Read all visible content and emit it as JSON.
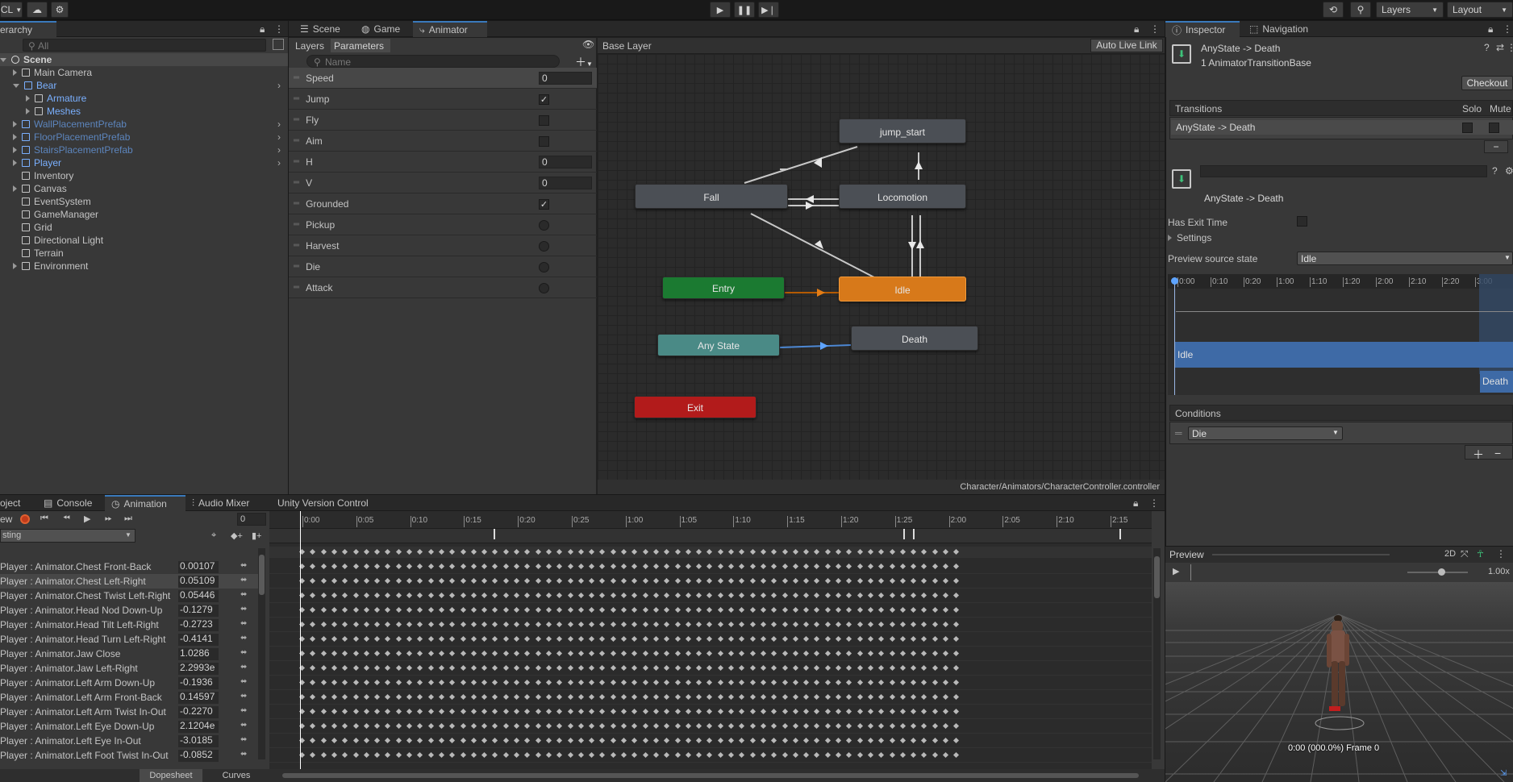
{
  "toolbar": {
    "account": "CL",
    "layers": "Layers",
    "layout": "Layout"
  },
  "hierarchy": {
    "tab": "erarchy",
    "search_placeholder": "All",
    "items": [
      {
        "label": "Scene",
        "depth": 0,
        "icon": "scene",
        "color": "#d2d2d2",
        "arrow": "down"
      },
      {
        "label": "Main Camera",
        "depth": 1,
        "icon": "cube",
        "color": "#c4c4c4",
        "arrow": "right"
      },
      {
        "label": "Bear",
        "depth": 1,
        "icon": "cube-blue",
        "color": "#7ab0ff",
        "arrow": "down"
      },
      {
        "label": "Armature",
        "depth": 2,
        "icon": "cube",
        "color": "#7ab0ff",
        "arrow": "right"
      },
      {
        "label": "Meshes",
        "depth": 2,
        "icon": "cube",
        "color": "#7ab0ff",
        "arrow": "right"
      },
      {
        "label": "WallPlacementPrefab",
        "depth": 1,
        "icon": "cube-blue",
        "color": "#5c85bd",
        "arrow": "right"
      },
      {
        "label": "FloorPlacementPrefab",
        "depth": 1,
        "icon": "cube-blue",
        "color": "#5c85bd",
        "arrow": "right"
      },
      {
        "label": "StairsPlacementPrefab",
        "depth": 1,
        "icon": "cube-blue",
        "color": "#5c85bd",
        "arrow": "right"
      },
      {
        "label": "Player",
        "depth": 1,
        "icon": "cube-blue",
        "color": "#7ab0ff",
        "arrow": "right"
      },
      {
        "label": "Inventory",
        "depth": 1,
        "icon": "cube",
        "color": "#c4c4c4",
        "arrow": ""
      },
      {
        "label": "Canvas",
        "depth": 1,
        "icon": "cube",
        "color": "#c4c4c4",
        "arrow": "right"
      },
      {
        "label": "EventSystem",
        "depth": 1,
        "icon": "cube",
        "color": "#c4c4c4",
        "arrow": ""
      },
      {
        "label": "GameManager",
        "depth": 1,
        "icon": "cube",
        "color": "#c4c4c4",
        "arrow": ""
      },
      {
        "label": "Grid",
        "depth": 1,
        "icon": "cube",
        "color": "#c4c4c4",
        "arrow": ""
      },
      {
        "label": "Directional Light",
        "depth": 1,
        "icon": "cube",
        "color": "#c4c4c4",
        "arrow": ""
      },
      {
        "label": "Terrain",
        "depth": 1,
        "icon": "cube",
        "color": "#c4c4c4",
        "arrow": ""
      },
      {
        "label": "Environment",
        "depth": 1,
        "icon": "cube",
        "color": "#c4c4c4",
        "arrow": "right"
      }
    ]
  },
  "center_tabs": {
    "scene": "Scene",
    "game": "Game",
    "animator": "Animator"
  },
  "animator": {
    "layers_tab": "Layers",
    "parameters_tab": "Parameters",
    "search_placeholder": "Name",
    "breadcrumb": "Base Layer",
    "auto_live_link": "Auto Live Link",
    "footer_path": "Character/Animators/CharacterController.controller",
    "parameters": [
      {
        "name": "Speed",
        "type": "float",
        "value": "0"
      },
      {
        "name": "Jump",
        "type": "bool",
        "value": true
      },
      {
        "name": "Fly",
        "type": "bool",
        "value": false
      },
      {
        "name": "Aim",
        "type": "bool",
        "value": false
      },
      {
        "name": "H",
        "type": "float",
        "value": "0"
      },
      {
        "name": "V",
        "type": "float",
        "value": "0"
      },
      {
        "name": "Grounded",
        "type": "bool",
        "value": true
      },
      {
        "name": "Pickup",
        "type": "trigger"
      },
      {
        "name": "Harvest",
        "type": "trigger"
      },
      {
        "name": "Die",
        "type": "trigger"
      },
      {
        "name": "Attack",
        "type": "trigger"
      }
    ],
    "states": {
      "jump_start": "jump_start",
      "fall": "Fall",
      "locomotion": "Locomotion",
      "entry": "Entry",
      "idle": "Idle",
      "any_state": "Any State",
      "death": "Death",
      "exit": "Exit"
    }
  },
  "inspector": {
    "tab_inspector": "Inspector",
    "tab_navigation": "Navigation",
    "title": "AnyState -> Death",
    "subtitle": "1 AnimatorTransitionBase",
    "checkout": "Checkout",
    "transitions_header": "Transitions",
    "solo": "Solo",
    "mute": "Mute",
    "transition_item": "AnyState -> Death",
    "transition_name": "AnyState -> Death",
    "has_exit_time": "Has Exit Time",
    "settings": "Settings",
    "preview_source_label": "Preview source state",
    "preview_source_value": "Idle",
    "timeline_labels": [
      "0:00",
      "0:10",
      "0:20",
      "1:00",
      "1:10",
      "1:20",
      "2:00",
      "2:10",
      "2:20",
      "3:00"
    ],
    "bar_idle": "Idle",
    "bar_death": "Death",
    "conditions_header": "Conditions",
    "condition_value": "Die"
  },
  "bottom_tabs": {
    "project": "oject",
    "console": "Console",
    "animation": "Animation",
    "audio_mixer": "Audio Mixer",
    "uvc": "Unity Version Control"
  },
  "animation": {
    "preview": "ew",
    "frame": "0",
    "clip": "sting",
    "dopesheet": "Dopesheet",
    "curves": "Curves",
    "ruler": [
      "0:00",
      "0:05",
      "0:10",
      "0:15",
      "0:20",
      "0:25",
      "1:00",
      "1:05",
      "1:10",
      "1:15",
      "1:20",
      "1:25",
      "2:00",
      "2:05",
      "2:10",
      "2:15"
    ],
    "properties": [
      {
        "name": "Player : Animator.Chest Front-Back",
        "value": "0.00107"
      },
      {
        "name": "Player : Animator.Chest Left-Right",
        "value": "0.05109"
      },
      {
        "name": "Player : Animator.Chest Twist Left-Right",
        "value": "0.05446"
      },
      {
        "name": "Player : Animator.Head Nod Down-Up",
        "value": "-0.1279"
      },
      {
        "name": "Player : Animator.Head Tilt Left-Right",
        "value": "-0.2723"
      },
      {
        "name": "Player : Animator.Head Turn Left-Right",
        "value": "-0.4141"
      },
      {
        "name": "Player : Animator.Jaw Close",
        "value": "1.0286"
      },
      {
        "name": "Player : Animator.Jaw Left-Right",
        "value": "2.2993e"
      },
      {
        "name": "Player : Animator.Left Arm Down-Up",
        "value": "-0.1936"
      },
      {
        "name": "Player : Animator.Left Arm Front-Back",
        "value": "0.14597"
      },
      {
        "name": "Player : Animator.Left Arm Twist In-Out",
        "value": "-0.2270"
      },
      {
        "name": "Player : Animator.Left Eye Down-Up",
        "value": "2.1204e"
      },
      {
        "name": "Player : Animator.Left Eye In-Out",
        "value": "-3.0185"
      },
      {
        "name": "Player : Animator.Left Foot Twist In-Out",
        "value": "-0.0852"
      }
    ]
  },
  "preview_panel": {
    "title": "Preview",
    "mode": "2D",
    "speed": "1.00x",
    "status": "0:00 (000.0%) Frame 0"
  }
}
